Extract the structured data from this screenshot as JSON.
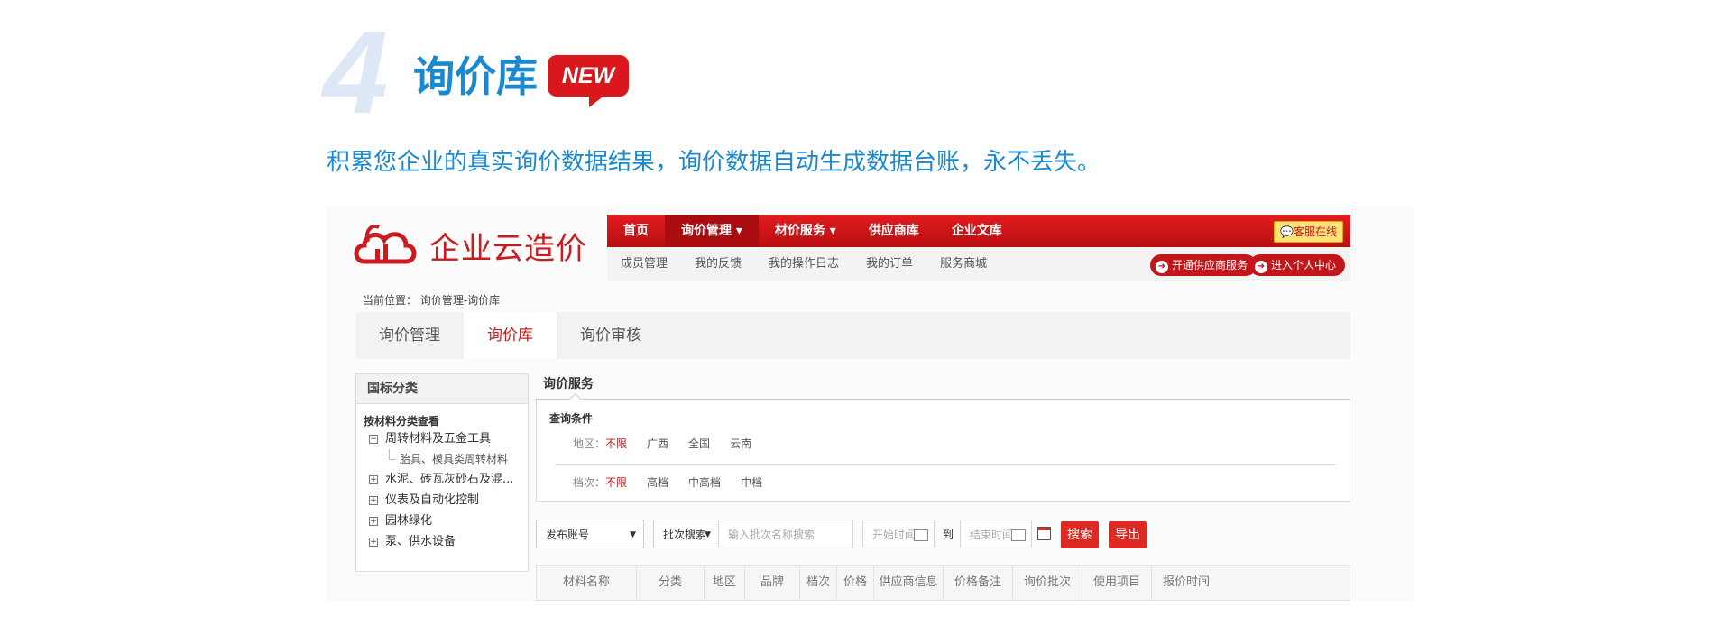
{
  "hero": {
    "number": "4",
    "title": "询价库",
    "badge": "NEW",
    "description": "积累您企业的真实询价数据结果，询价数据自动生成数据台账，永不丢失。"
  },
  "app": {
    "logo_text": "企业云造价",
    "nav": [
      "首页",
      "询价管理 ▾",
      "材价服务 ▾",
      "供应商库",
      "企业文库"
    ],
    "customer_service": "客服在线",
    "subnav": [
      "成员管理",
      "我的反馈",
      "我的操作日志",
      "我的订单",
      "服务商城"
    ],
    "open_supplier": "开通供应商服务",
    "personal_center": "进入个人中心",
    "breadcrumb": "当前位置：  询价管理-询价库",
    "tabs": [
      "询价管理",
      "询价库",
      "询价审核"
    ],
    "active_tab": "询价库"
  },
  "sidebar": {
    "title": "国标分类",
    "subtitle": "按材料分类查看",
    "items": [
      {
        "label": "周转材料及五金工具",
        "expand": "⊟"
      },
      {
        "label": "胎具、模具类周转材料",
        "child": true
      },
      {
        "label": "水泥、砖瓦灰砂石及混...",
        "expand": "⊞"
      },
      {
        "label": "仪表及自动化控制",
        "expand": "⊞"
      },
      {
        "label": "园林绿化",
        "expand": "⊞"
      },
      {
        "label": "泵、供水设备",
        "expand": "⊞"
      }
    ]
  },
  "main": {
    "panel_title": "询价服务",
    "filter_title": "查询条件",
    "region_label": "地区：",
    "region_options": [
      "不限",
      "广西",
      "全国",
      "云南"
    ],
    "grade_label": "档次：",
    "grade_options": [
      "不限",
      "高档",
      "中高档",
      "中档"
    ],
    "account_select": "发布账号",
    "batch_select": "批次搜索",
    "batch_placeholder": "输入批次名称搜索",
    "start_placeholder": "开始时间",
    "to_label": "到",
    "end_placeholder": "结束时间",
    "search_btn": "搜索",
    "export_btn": "导出",
    "columns": [
      "材料名称",
      "分类",
      "地区",
      "品牌",
      "档次",
      "价格",
      "供应商信息",
      "价格备注",
      "询价批次",
      "使用项目",
      "报价时间"
    ]
  },
  "colors": {
    "accent_blue": "#1a89cf",
    "brand_red": "#cc1b1f"
  }
}
